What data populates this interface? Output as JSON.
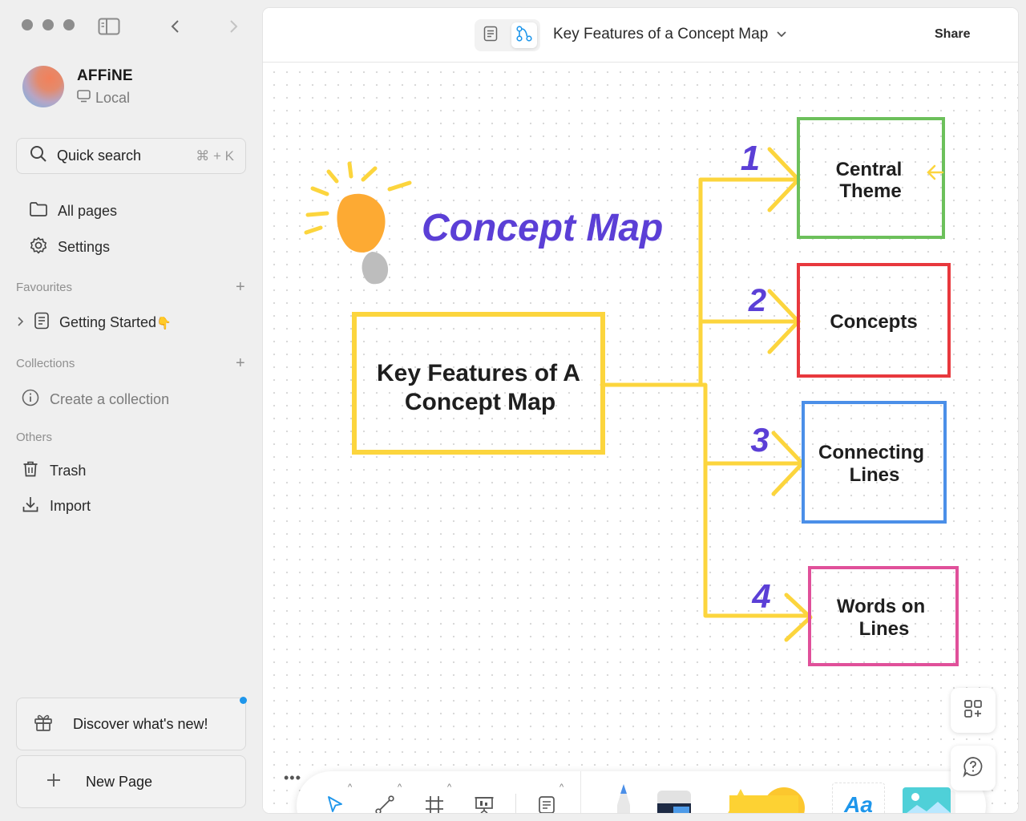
{
  "sidebar": {
    "workspace": {
      "name": "AFFiNE",
      "type": "Local"
    },
    "search": {
      "label": "Quick search",
      "shortcut": "⌘ + K"
    },
    "nav": {
      "all_pages": "All pages",
      "settings": "Settings"
    },
    "favourites": {
      "label": "Favourites",
      "items": [
        {
          "label": "Getting Started",
          "emoji": "👇"
        }
      ]
    },
    "collections": {
      "label": "Collections",
      "create": "Create a collection"
    },
    "others": {
      "label": "Others",
      "trash": "Trash",
      "import": "Import"
    },
    "discover": "Discover what's new!",
    "new_page": "New Page"
  },
  "header": {
    "title": "Key Features of a Concept Map",
    "share": "Share"
  },
  "canvas": {
    "heading": "Concept Map",
    "main_box": [
      "Key Features of A",
      "Concept Map"
    ],
    "branches": [
      {
        "number": "1",
        "lines": [
          "Central",
          "Theme"
        ],
        "color": "#6cc05b"
      },
      {
        "number": "2",
        "lines": [
          "Concepts"
        ],
        "color": "#e8383d"
      },
      {
        "number": "3",
        "lines": [
          "Connecting",
          "Lines"
        ],
        "color": "#4b8fe8"
      },
      {
        "number": "4",
        "lines": [
          "Words on",
          "Lines"
        ],
        "color": "#e0509a"
      }
    ],
    "accent_purple": "#5b3fd6",
    "connector_yellow": "#fcd53d"
  },
  "toolbar": {
    "text_tool_label": "Aa"
  }
}
